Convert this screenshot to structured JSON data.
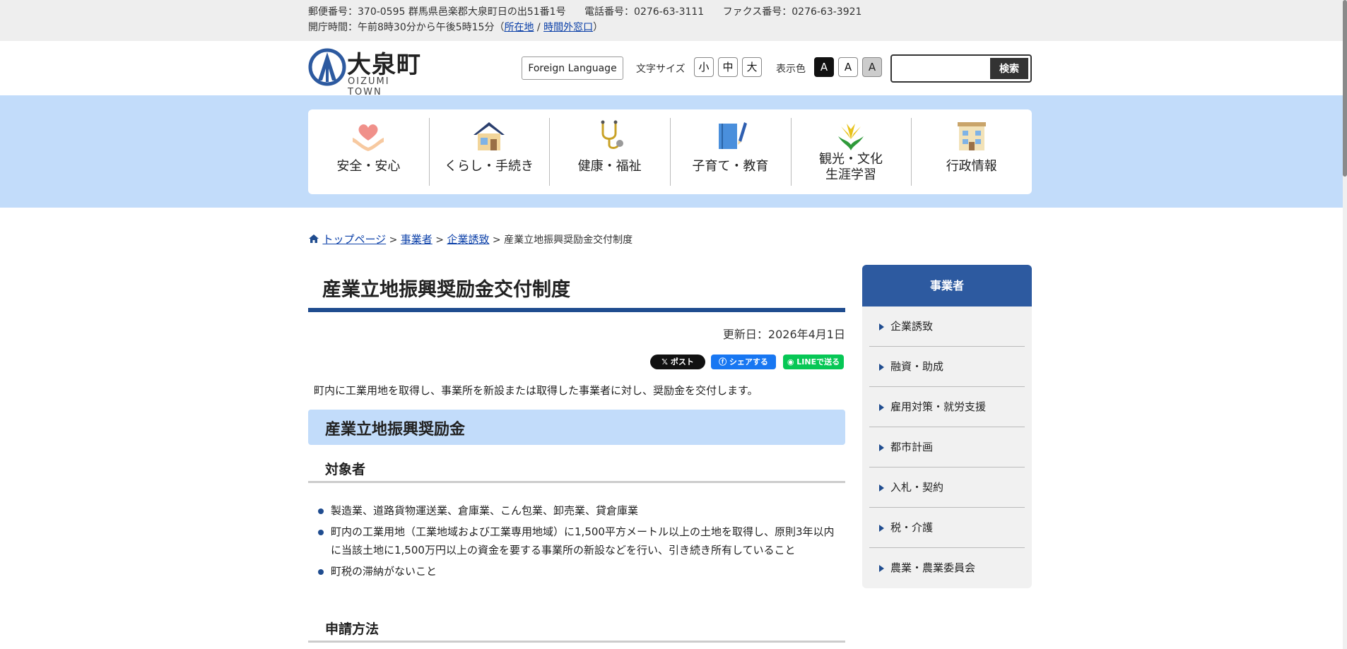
{
  "topbar": {
    "postal": "郵便番号：370-0595 群馬県邑楽郡大泉町日の出51番1号",
    "phone": "電話番号：0276-63-3111",
    "fax": "ファクス番号：0276-63-3921",
    "hours_prefix": "開庁時間：午前8時30分から午後5時15分（",
    "link_location": "所在地",
    "separator": " / ",
    "link_after_hours": "時間外窓口",
    "hours_suffix": "）"
  },
  "header": {
    "logo_name": "大泉町",
    "logo_roman": "OIZUMI  TOWN",
    "foreign_language": "Foreign Language",
    "font_size_label": "文字サイズ",
    "font_small": "小",
    "font_medium": "中",
    "font_large": "大",
    "color_label": "表示色",
    "color_a1": "A",
    "color_a2": "A",
    "color_a3": "A",
    "search_placeholder": "",
    "search_button": "検索"
  },
  "nav": [
    {
      "label": "安全・安心",
      "icon": "heart-hands-icon"
    },
    {
      "label": "くらし・手続き",
      "icon": "house-icon"
    },
    {
      "label": "健康・福祉",
      "icon": "stethoscope-icon"
    },
    {
      "label": "子育て・教育",
      "icon": "notebook-pencil-icon"
    },
    {
      "label1": "観光・文化",
      "label2": "生涯学習",
      "icon": "flower-icon"
    },
    {
      "label": "行政情報",
      "icon": "building-icon"
    }
  ],
  "breadcrumb": {
    "home": "トップページ",
    "sep": " > ",
    "c1": "事業者",
    "c2": "企業誘致",
    "current": "産業立地振興奨励金交付制度"
  },
  "main": {
    "title": "産業立地振興奨励金交付制度",
    "updated": "更新日：2026年4月1日",
    "share_x": "ポスト",
    "share_fb": "シェアする",
    "share_line": "LINEで送る",
    "intro": "町内に工業用地を取得し、事業所を新設または取得した事業者に対し、奨励金を交付します。",
    "section_title": "産業立地振興奨励金",
    "sub1": "対象者",
    "bullets": [
      "製造業、道路貨物運送業、倉庫業、こん包業、卸売業、貸倉庫業",
      "町内の工業用地（工業地域および工業専用地域）に1,500平方メートル以上の土地を取得し、原則3年以内に当該土地に1,500万円以上の資金を要する事業所の新設などを行い、引き続き所有していること",
      "町税の滞納がないこと"
    ],
    "sub2": "申請方法"
  },
  "sidebar": {
    "heading": "事業者",
    "items": [
      "企業誘致",
      "融資・助成",
      "雇用対策・就労支援",
      "都市計画",
      "入札・契約",
      "税・介護",
      "農業・農業委員会"
    ]
  },
  "colors": {
    "accent": "#1f4c8f",
    "nav_band": "#c2dcfa",
    "sidebar_head": "#2d5aa0"
  }
}
